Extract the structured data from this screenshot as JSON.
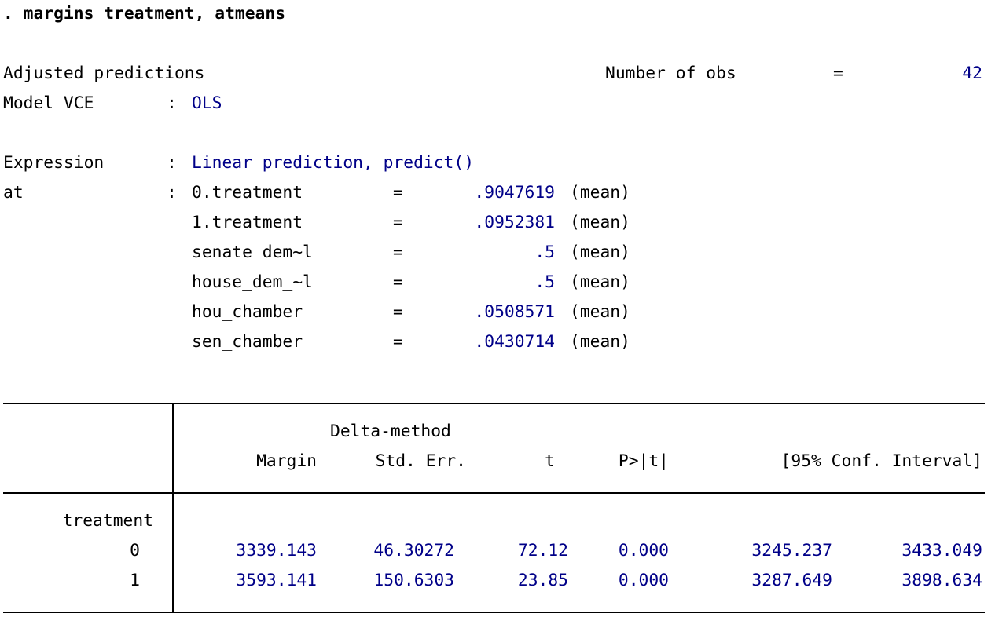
{
  "command": ". margins treatment, atmeans",
  "header": {
    "title": "Adjusted predictions",
    "nobs_label": "Number of obs",
    "nobs_eq": "=",
    "nobs_value": "42",
    "vce_label": "Model VCE",
    "colon": ":",
    "vce_value": "OLS",
    "expr_label": "Expression",
    "expr_value": "Linear prediction, predict()",
    "at_label": "at"
  },
  "at_rows": [
    {
      "name": "0.treatment",
      "eq": "=",
      "value": ".9047619",
      "stat": "(mean)"
    },
    {
      "name": "1.treatment",
      "eq": "=",
      "value": ".0952381",
      "stat": "(mean)"
    },
    {
      "name": "senate_dem~l",
      "eq": "=",
      "value": ".5",
      "stat": "(mean)"
    },
    {
      "name": "house_dem_~l",
      "eq": "=",
      "value": ".5",
      "stat": "(mean)"
    },
    {
      "name": "hou_chamber",
      "eq": "=",
      "value": ".0508571",
      "stat": "(mean)"
    },
    {
      "name": "sen_chamber",
      "eq": "=",
      "value": ".0430714",
      "stat": "(mean)"
    }
  ],
  "table": {
    "delta_method": "Delta-method",
    "columns": [
      "Margin",
      "Std. Err.",
      "t",
      "P>|t|",
      "[95% Conf. Interval]"
    ],
    "group_label": "treatment",
    "rows": [
      {
        "level": "0",
        "margin": "3339.143",
        "se": "46.30272",
        "t": "72.12",
        "p": "0.000",
        "ci_low": "3245.237",
        "ci_high": "3433.049"
      },
      {
        "level": "1",
        "margin": "3593.141",
        "se": "150.6303",
        "t": "23.85",
        "p": "0.000",
        "ci_low": "3287.649",
        "ci_high": "3898.634"
      }
    ]
  },
  "colors": {
    "text": "#000000",
    "result": "#000088",
    "background": "#ffffff"
  }
}
